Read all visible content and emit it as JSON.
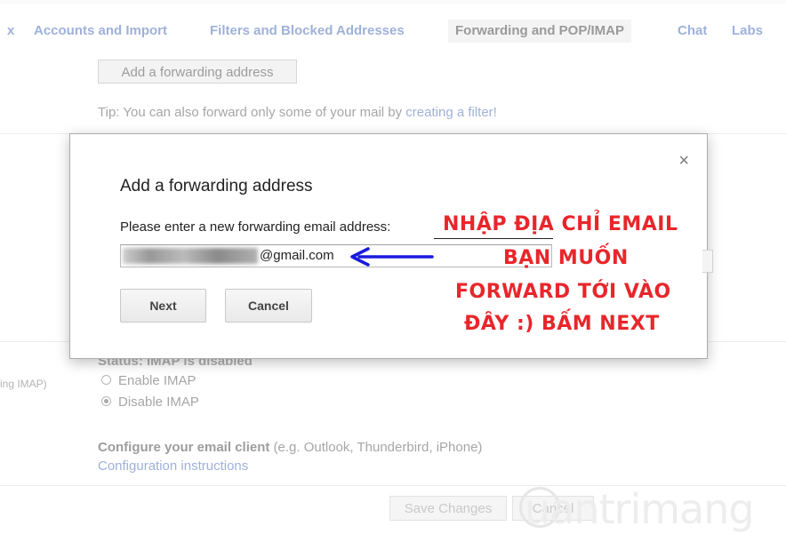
{
  "tabs": [
    {
      "label": "x"
    },
    {
      "label": "Accounts and Import"
    },
    {
      "label": "Filters and Blocked Addresses"
    },
    {
      "label": "Forwarding and POP/IMAP"
    },
    {
      "label": "Chat"
    },
    {
      "label": "Labs"
    }
  ],
  "forwarding": {
    "add_button_label": "Add a forwarding address",
    "tip_text": "Tip: You can also forward only some of your mail by ",
    "tip_link": "creating a filter!"
  },
  "imap": {
    "status_label": "Status: IMAP is disabled",
    "side_note": "ing IMAP)",
    "enable_label": "Enable IMAP",
    "disable_label": "Disable IMAP",
    "config_title": "Configure your email client",
    "config_hint": " (e.g. Outlook, Thunderbird, iPhone)",
    "config_link": "Configuration instructions"
  },
  "footer": {
    "save_label": "Save Changes",
    "cancel_label": "Cancel",
    "watermark": "uantrimang"
  },
  "modal": {
    "close_symbol": "×",
    "title": "Add a forwarding address",
    "prompt": "Please enter a new forwarding email address:",
    "email_value": "@gmail.com",
    "next_label": "Next",
    "cancel_label": "Cancel"
  },
  "annotation": {
    "line1": "NHẬP ĐỊA CHỈ EMAIL",
    "line2": "BẠN MUỐN",
    "line3": "FORWARD TỚI VÀO",
    "line4": "ĐÂY :) BẤM NEXT",
    "color": "#e8262b",
    "arrow_color": "#1a1adf"
  }
}
